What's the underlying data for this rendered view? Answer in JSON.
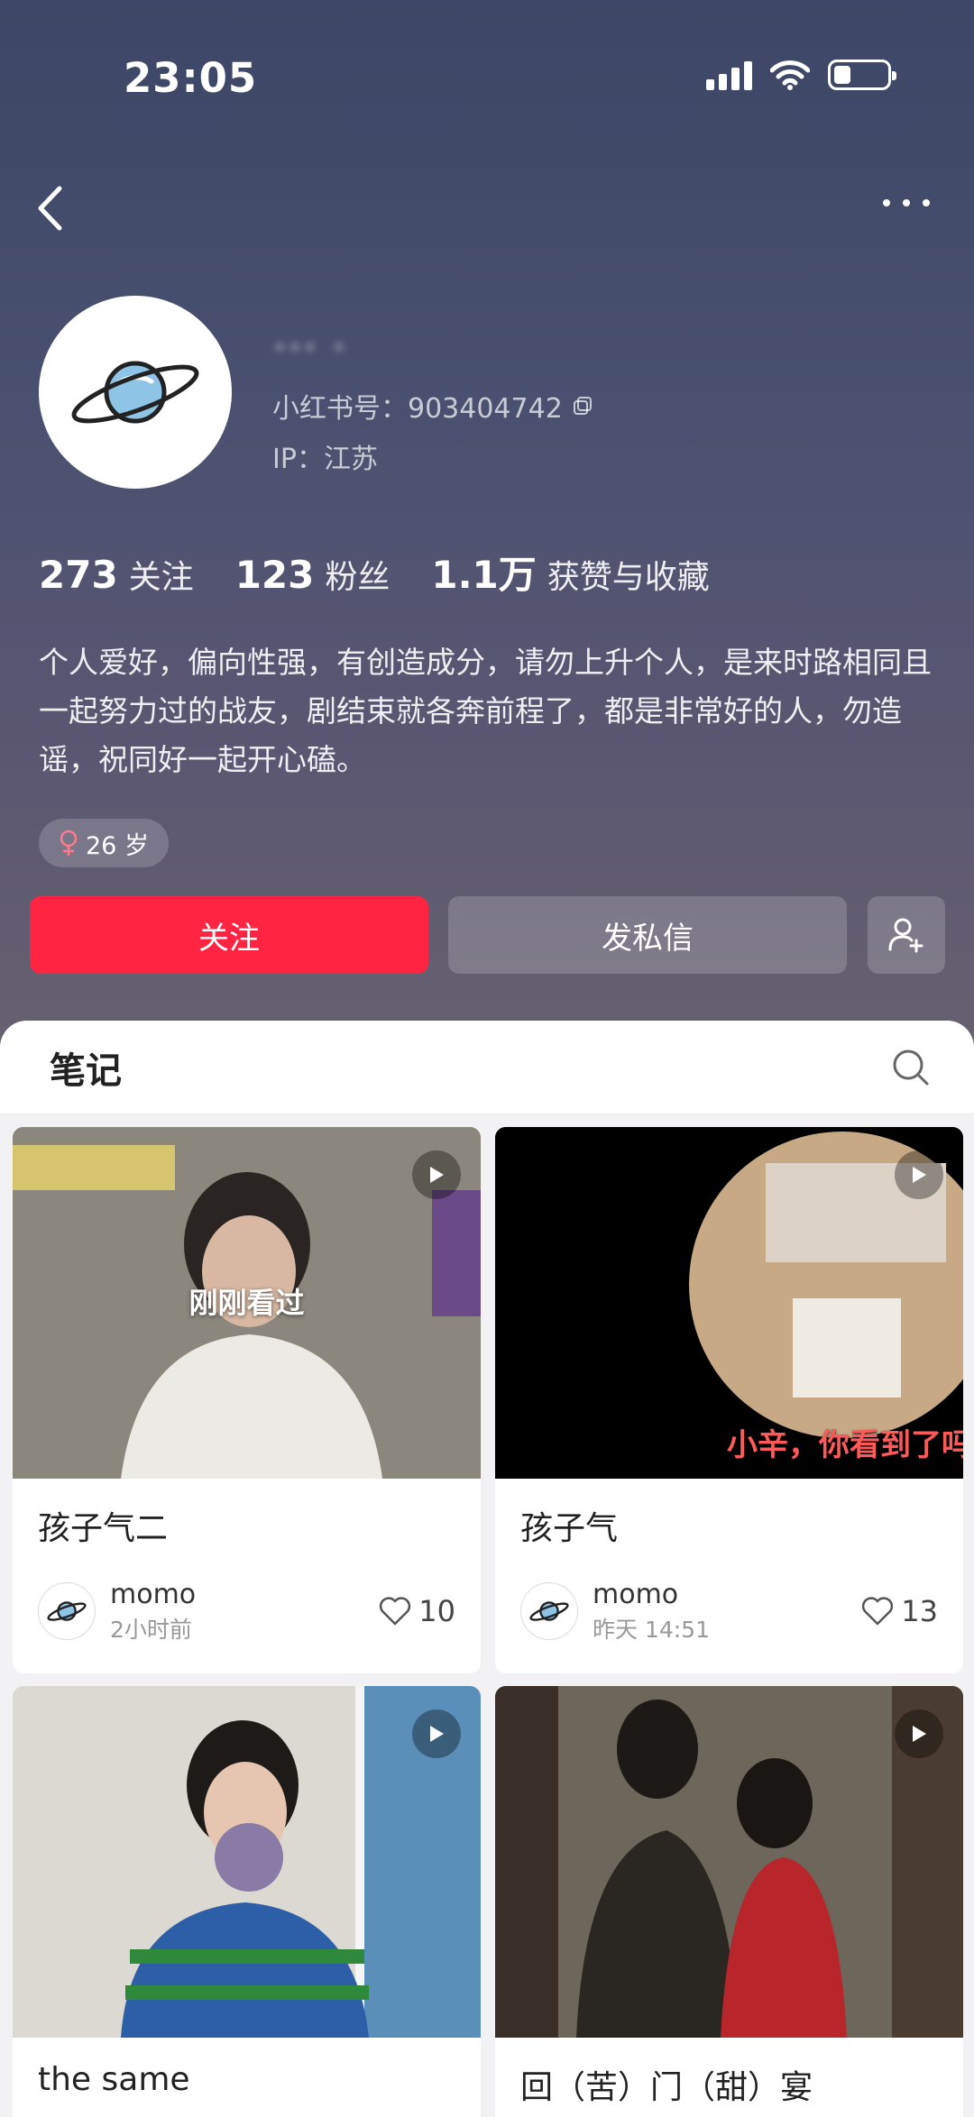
{
  "status_bar": {
    "time": "23:05"
  },
  "profile": {
    "username": "··· ·",
    "red_id_label": "小红书号：903404742",
    "ip_label": "IP：江苏",
    "stats": [
      {
        "value": "273",
        "label": "关注"
      },
      {
        "value": "123",
        "label": "粉丝"
      },
      {
        "value": "1.1万",
        "label": "获赞与收藏"
      }
    ],
    "bio": "个人爱好，偏向性强，有创造成分，请勿上升个人，是来时路相同且一起努力过的战友，剧结束就各奔前程了，都是非常好的人，勿造谣，祝同好一起开心磕。",
    "tag": "26 岁",
    "buttons": {
      "follow": "关注",
      "message": "发私信"
    }
  },
  "tabs": {
    "notes": "笔记"
  },
  "notes": [
    {
      "title": "孩子气二",
      "author": "momo",
      "time": "2小时前",
      "likes": "10",
      "overlay": "刚刚看过",
      "thumb_colors": [
        "#8a857c",
        "#c9c2b5"
      ]
    },
    {
      "title": "孩子气",
      "author": "momo",
      "time": "昨天 14:51",
      "likes": "13",
      "subtitle": "小辛，你看到了吗",
      "thumb_colors": [
        "#000000",
        "#b99a74"
      ]
    },
    {
      "title": "the same",
      "author": "",
      "time": "",
      "likes": "",
      "thumb_colors": [
        "#d8d4cf",
        "#2f6aa0"
      ]
    },
    {
      "title": "回（苦）门（甜）宴",
      "author": "",
      "time": "",
      "likes": "",
      "thumb_colors": [
        "#5a5448",
        "#9c2a2e"
      ]
    }
  ],
  "colors": {
    "accent": "#ff2442"
  }
}
